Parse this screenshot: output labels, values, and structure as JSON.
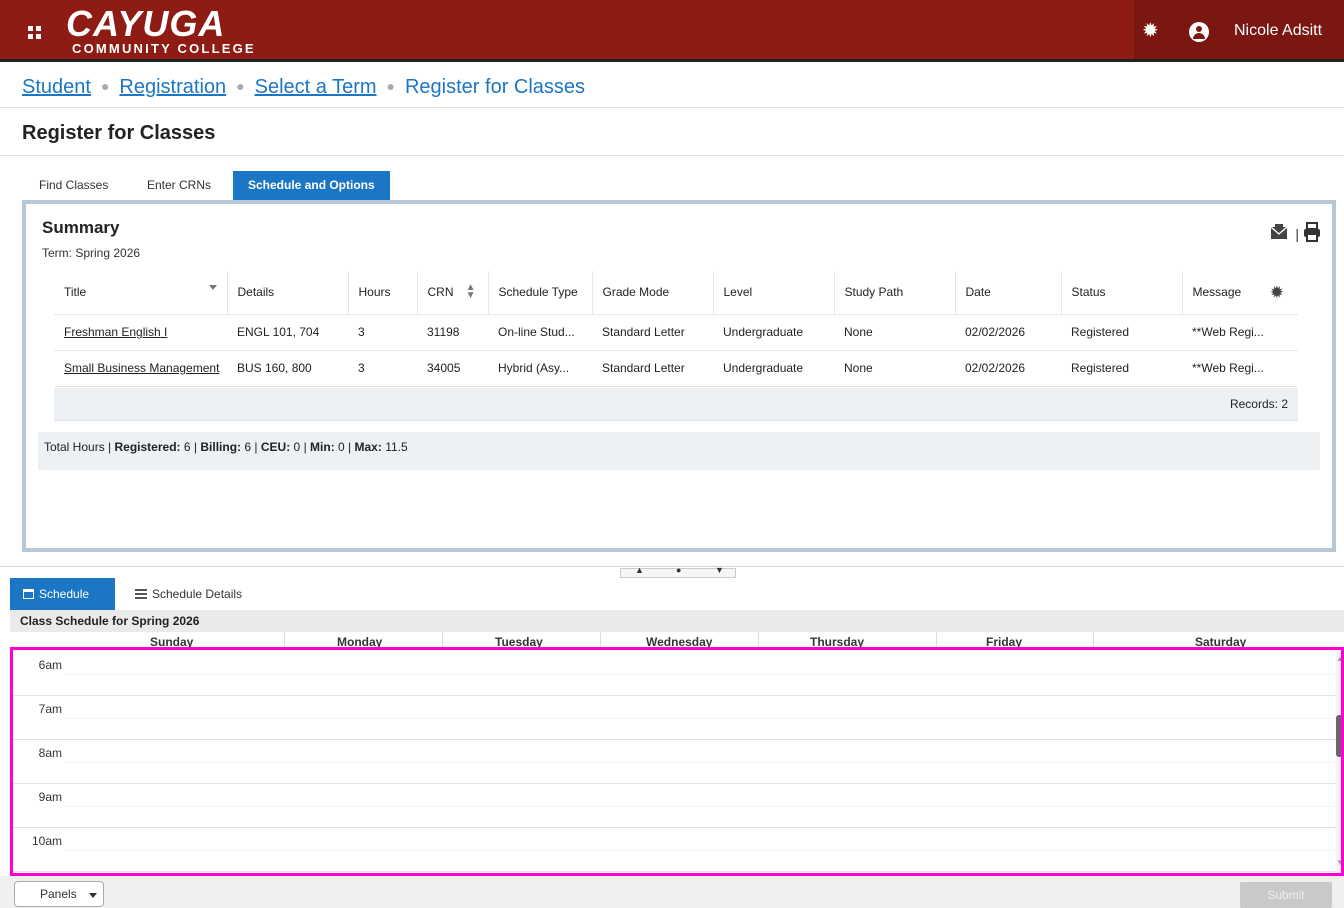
{
  "header": {
    "logo_main": "CAYUGA",
    "logo_sub": "COMMUNITY COLLEGE",
    "user_name": "Nicole Adsitt",
    "icons": [
      "grid-icon",
      "gear-icon",
      "user-icon"
    ]
  },
  "breadcrumb": {
    "items": [
      "Student",
      "Registration",
      "Select a Term"
    ],
    "current": "Register for Classes"
  },
  "page": {
    "title": "Register for Classes"
  },
  "tabs": [
    "Find Classes",
    "Enter CRNs",
    "Schedule and Options"
  ],
  "summary": {
    "title": "Summary",
    "term": "Term: Spring 2026",
    "columns": [
      "Title",
      "Details",
      "Hours",
      "CRN",
      "Schedule Type",
      "Grade Mode",
      "Level",
      "Study Path",
      "Date",
      "Status",
      "Message"
    ],
    "rows": [
      [
        "Freshman English I",
        "ENGL 101, 704",
        "3",
        "31198",
        "On-line Stud...",
        "Standard Letter",
        "Undergraduate",
        "None",
        "02/02/2026",
        "Registered",
        "**Web Regi..."
      ],
      [
        "Small Business Management",
        "BUS 160, 800",
        "3",
        "34005",
        "Hybrid (Asy...",
        "Standard Letter",
        "Undergraduate",
        "None",
        "02/02/2026",
        "Registered",
        "**Web Regi..."
      ]
    ],
    "records": "Records: 2",
    "totals": {
      "label": "Total Hours |",
      "registered_label": "Registered:",
      "registered": "6",
      "billing_label": "Billing:",
      "billing": "6",
      "ceu_label": "CEU:",
      "ceu": "0",
      "min_label": "Min:",
      "min": "0",
      "max_label": "Max:",
      "max": "11.5"
    }
  },
  "bottom_tabs": [
    "Schedule",
    "Schedule Details"
  ],
  "schedule": {
    "title": "Class Schedule for Spring 2026",
    "days": [
      "Sunday",
      "Monday",
      "Tuesday",
      "Wednesday",
      "Thursday",
      "Friday",
      "Saturday"
    ],
    "hours": [
      "6am",
      "7am",
      "8am",
      "9am",
      "10am"
    ]
  },
  "footer": {
    "panels_label": "Panels",
    "submit_label": "Submit"
  },
  "colors": {
    "brand": "#8e1b14",
    "accent": "#1b76c5",
    "highlight": "#ff00d4"
  }
}
